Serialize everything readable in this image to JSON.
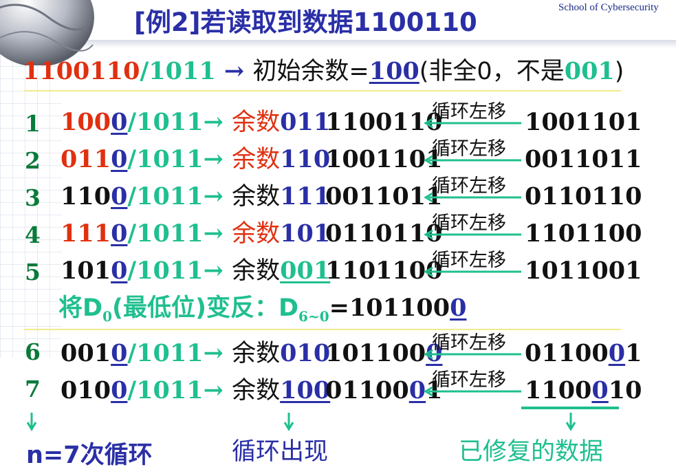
{
  "header": {
    "title": "[例2]若读取到数据1100110",
    "school": "School of Cybersecurity"
  },
  "intro": {
    "divide": "1100110",
    "by": "/1011",
    "arrow": " → ",
    "label": "初始余数=",
    "remainder": "100",
    "note_open": "(非全0，不是",
    "note_code": "001",
    "note_close": ")"
  },
  "shift_label": "循环左移",
  "steps": [
    {
      "n": "1",
      "d1": "100",
      "d2": "0",
      "div": "/1011→ ",
      "rlabel": "余数",
      "rem": "011",
      "val": "1100110",
      "next": "1001101"
    },
    {
      "n": "2",
      "d1": "011",
      "d2": "0",
      "div": "/1011→ ",
      "rlabel": "余数",
      "rem": "110",
      "val": "1001101",
      "next": "0011011"
    },
    {
      "n": "3",
      "d1": "110",
      "d2": "0",
      "div": "/1011→ ",
      "rlabel": "余数",
      "rem": "111",
      "val": "0011011",
      "next": "0110110"
    },
    {
      "n": "4",
      "d1": "111",
      "d2": "0",
      "div": "/1011→ ",
      "rlabel": "余数",
      "rem": "101",
      "val": "0110110",
      "next": "1101100"
    },
    {
      "n": "5",
      "d1": "101",
      "d2": "0",
      "div": "/1011→ ",
      "rlabel": "余数",
      "rem": "001",
      "val": "1101100",
      "next": "1011001"
    }
  ],
  "correction": {
    "prefix": "将D",
    "sub0": "0",
    "mid": "(最低位)变反：D",
    "sub1": "6~0",
    "eq": "=101100",
    "last": "0"
  },
  "steps2": [
    {
      "n": "6",
      "d1": "001",
      "d2": "0",
      "div": "/1011→ ",
      "rlabel": "余数",
      "rem": "010",
      "val_a": "101100",
      "val_b": "0",
      "next_a": "01100",
      "next_b": "0",
      "next_c": "1"
    },
    {
      "n": "7",
      "d1": "010",
      "d2": "0",
      "div": "/1011→ ",
      "rlabel": "余数",
      "rem": "100",
      "val_a": "01100",
      "val_b": "0",
      "val_c": "1",
      "next_a": "1100",
      "next_b": "0",
      "next_c": "10"
    }
  ],
  "footer": {
    "left": "n=7次循环",
    "middle": "循环出现",
    "right": "已修复的数据"
  },
  "colors": {
    "blue": "#2a2fa6",
    "green": "#1fbf8f",
    "red": "#e03010",
    "dark_green": "#0a7a3a"
  }
}
